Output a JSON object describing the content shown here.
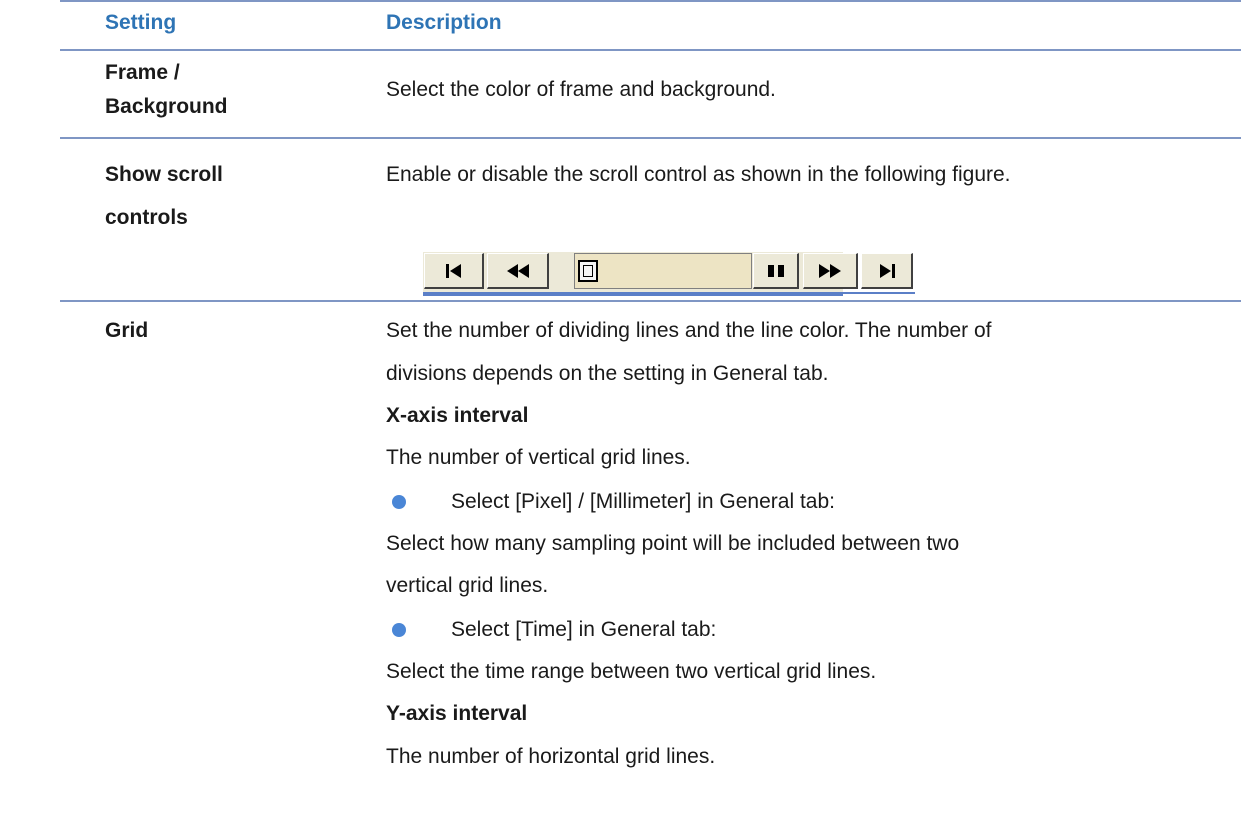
{
  "header": {
    "setting": "Setting",
    "description": "Description"
  },
  "rows": {
    "frame": {
      "label_line1": "Frame /",
      "label_line2": "Background",
      "description": "Select the color of frame and background."
    },
    "scroll": {
      "label_line1": "Show scroll",
      "label_line2": "controls",
      "description": "Enable or disable the scroll control as shown in the following figure.",
      "figure_buttons": [
        "first-icon",
        "rewind-icon",
        "pause-icon",
        "fast-forward-icon",
        "last-icon"
      ]
    },
    "grid": {
      "label": "Grid",
      "line1": "Set the number of dividing lines and the line color. The number of",
      "line2": "divisions depends on the setting in General tab.",
      "x_heading": "X-axis interval",
      "x_desc": "The number of vertical grid lines.",
      "bullet1": "Select [Pixel] / [Millimeter] in General tab:",
      "bullet1_desc1": "Select how many sampling point will be included between two",
      "bullet1_desc2": "vertical grid lines.",
      "bullet2": "Select [Time] in General tab:",
      "bullet2_desc": "Select the time range between two vertical grid lines.",
      "y_heading": "Y-axis interval",
      "y_desc": "The number of horizontal grid lines."
    }
  },
  "colors": {
    "header_text": "#2e74b5",
    "rule": "#7f96c4",
    "bullet": "#4a86d6"
  }
}
